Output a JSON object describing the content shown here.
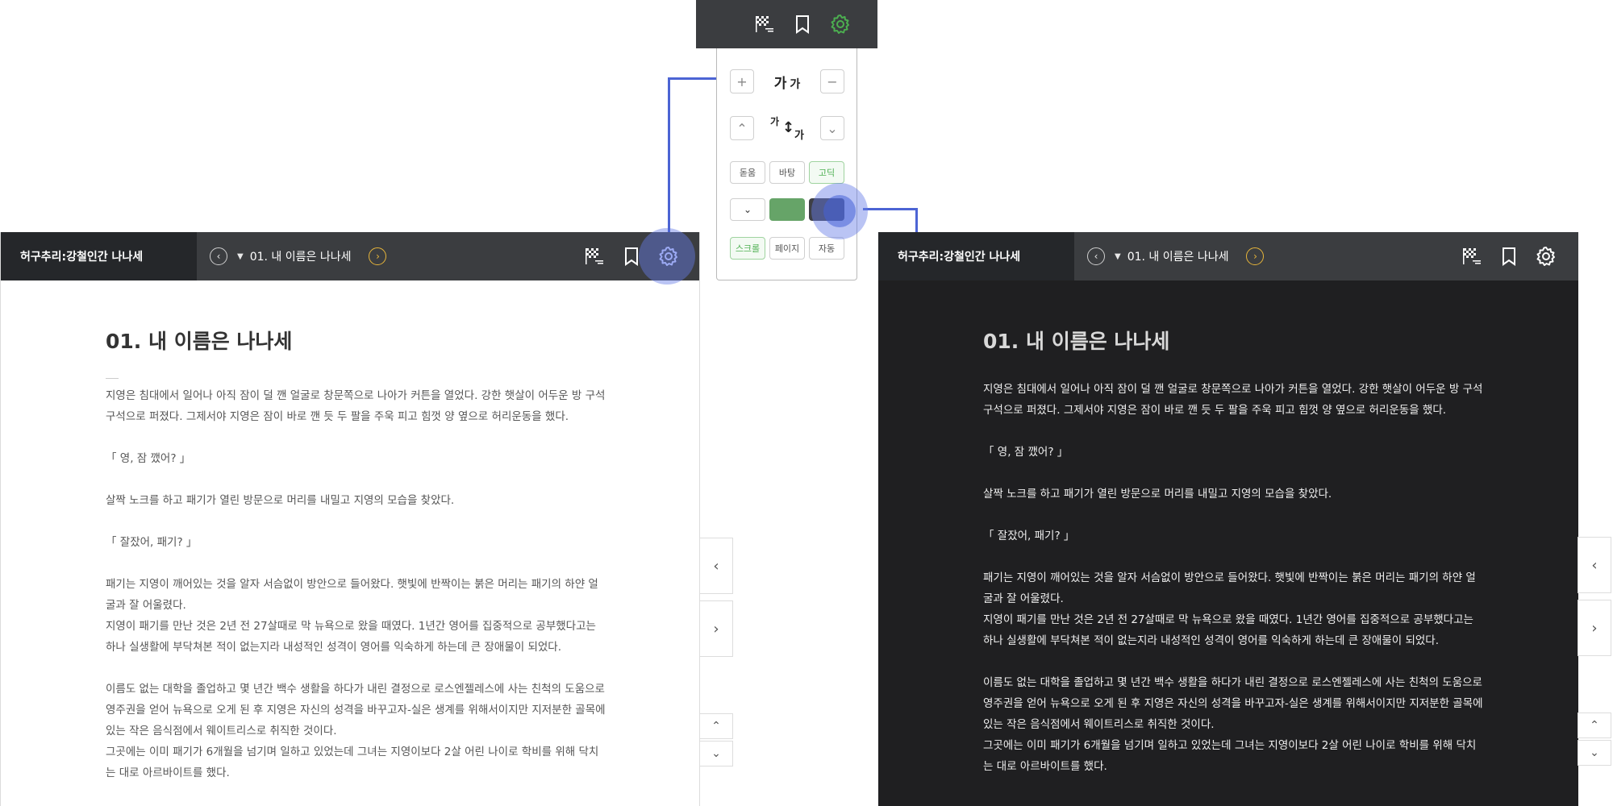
{
  "colors": {
    "accent_green": "#4caf50",
    "highlight_blue": "#4c64d4",
    "next_arrow": "#e7b53a"
  },
  "readers": [
    {
      "mode": "light",
      "book_title": "허구추리:강철인간 나나세",
      "chapter": "01. 내 이름은 나나세",
      "chapter_heading": "01. 내 이름은 나나세",
      "paragraphs": [
        "지영은 침대에서 일어나 아직 잠이 덜 깬 얼굴로 창문쪽으로 나아가 커튼을 열었다. 강한 햇살이 어두운 방 구석구석으로 퍼졌다. 그제서야 지영은 잠이 바로 깬 듯 두 팔을 주욱 피고 힘껏 양 옆으로 허리운동을 했다.",
        "「 영, 잠 깼어? 」",
        "살짝 노크를 하고 패기가 열린 방문으로 머리를 내밀고 지영의 모습을 찾았다.",
        "「 잘잤어, 패기? 」",
        "패기는 지영이 깨어있는 것을 알자 서슴없이 방안으로 들어왔다. 햇빛에 반짝이는 붉은 머리는 패기의 하얀 얼굴과 잘 어울렸다.",
        "지영이 패기를 만난 것은 2년 전 27살때로 막 뉴욕으로 왔을 때였다. 1년간 영어를 집중적으로 공부했다고는 하나 실생활에 부닥쳐본 적이 없는지라 내성적인 성격이 영어를 익숙하게 하는데 큰 장애물이 되었다.",
        "이름도 없는 대학을 졸업하고 몇 년간 백수 생활을 하다가 내린 결정으로 로스엔젤레스에 사는 친척의 도움으로 영주권을 얻어 뉴욕으로 오게 된 후 지영은 자신의 성격을 바꾸고자-실은 생계를 위해서이지만 지저분한 골목에 있는 작은 음식점에서 웨이트리스로 취직한 것이다.",
        "그곳에는 이미 패기가 6개월을 넘기며 일하고 있었는데 그녀는 지영이보다 2살 어린 나이로 학비를 위해 닥치는 대로 아르바이트를 했다."
      ]
    },
    {
      "mode": "dark",
      "book_title": "허구추리:강철인간 나나세",
      "chapter": "01. 내 이름은 나나세",
      "chapter_heading": "01. 내 이름은 나나세",
      "paragraphs": [
        "지영은 침대에서 일어나 아직 잠이 덜 깬 얼굴로 창문쪽으로 나아가 커튼을 열었다. 강한 햇살이 어두운 방 구석구석으로 퍼졌다. 그제서야 지영은 잠이 바로 깬 듯 두 팔을 주욱 피고 힘껏 양 옆으로 허리운동을 했다.",
        "「 영, 잠 깼어? 」",
        "살짝 노크를 하고 패기가 열린 방문으로 머리를 내밀고 지영의 모습을 찾았다.",
        "「 잘잤어, 패기? 」",
        "패기는 지영이 깨어있는 것을 알자 서슴없이 방안으로 들어왔다. 햇빛에 반짝이는 붉은 머리는 패기의 하얀 얼굴과 잘 어울렸다.",
        "지영이 패기를 만난 것은 2년 전 27살때로 막 뉴욕으로 왔을 때였다. 1년간 영어를 집중적으로 공부했다고는 하나 실생활에 부닥쳐본 적이 없는지라 내성적인 성격이 영어를 익숙하게 하는데 큰 장애물이 되었다.",
        "이름도 없는 대학을 졸업하고 몇 년간 백수 생활을 하다가 내린 결정으로 로스엔젤레스에 사는 친척의 도움으로 영주권을 얻어 뉴욕으로 오게 된 후 지영은 자신의 성격을 바꾸고자-실은 생계를 위해서이지만 지저분한 골목에 있는 작은 음식점에서 웨이트리스로 취직한 것이다.",
        "그곳에는 이미 패기가 6개월을 넘기며 일하고 있었는데 그녀는 지영이보다 2살 어린 나이로 학비를 위해 닥치는 대로 아르바이트를 했다."
      ]
    }
  ],
  "settings": {
    "font_size_big": "가",
    "font_size_small": "가",
    "line_height_top": "가",
    "line_height_bottom": "가",
    "fonts": [
      "돋움",
      "바탕",
      "고딕"
    ],
    "active_font": "고딕",
    "modes": [
      "스크롤",
      "페이지",
      "자동"
    ],
    "active_mode": "스크롤",
    "swatches": {
      "green": "#66a468",
      "dark": "#3e3f45"
    }
  },
  "icons": {
    "plus": "+",
    "minus": "−",
    "up": "⌃",
    "down": "⌄",
    "check": "✓",
    "prev": "‹",
    "next": "›",
    "caret": "▼"
  }
}
